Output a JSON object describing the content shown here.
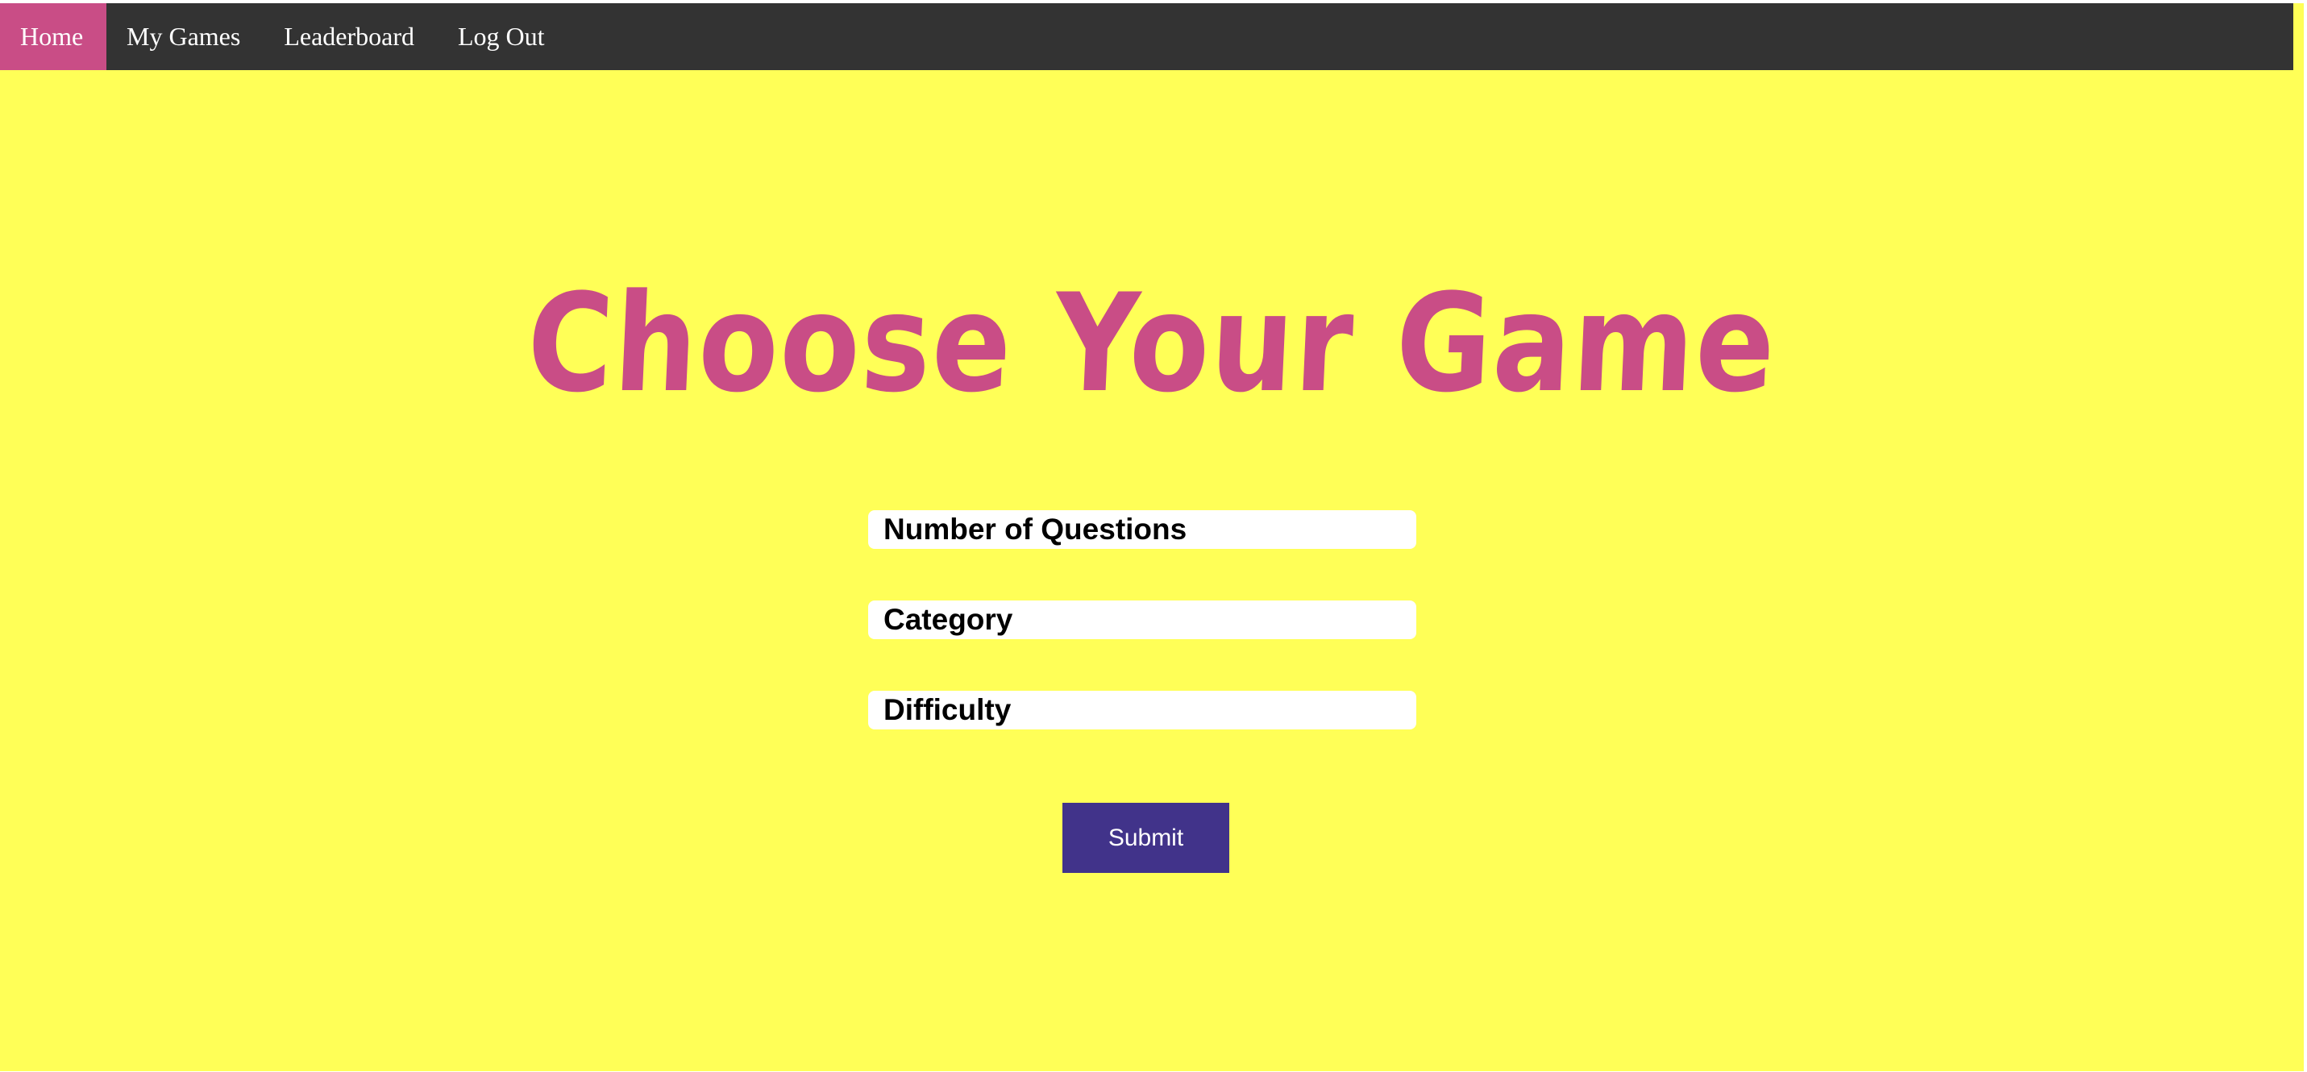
{
  "nav": {
    "items": [
      {
        "label": "Home",
        "active": true
      },
      {
        "label": "My Games"
      },
      {
        "label": "Leaderboard"
      },
      {
        "label": "Log Out"
      }
    ]
  },
  "main": {
    "title": "Choose Your Game",
    "fields": [
      {
        "label": "Number of Questions"
      },
      {
        "label": "Category"
      },
      {
        "label": "Difficulty"
      }
    ],
    "submit_label": "Submit"
  },
  "colors": {
    "background": "#ffff57",
    "navbar": "#333333",
    "accent": "#c94d86",
    "button": "#41338a"
  }
}
